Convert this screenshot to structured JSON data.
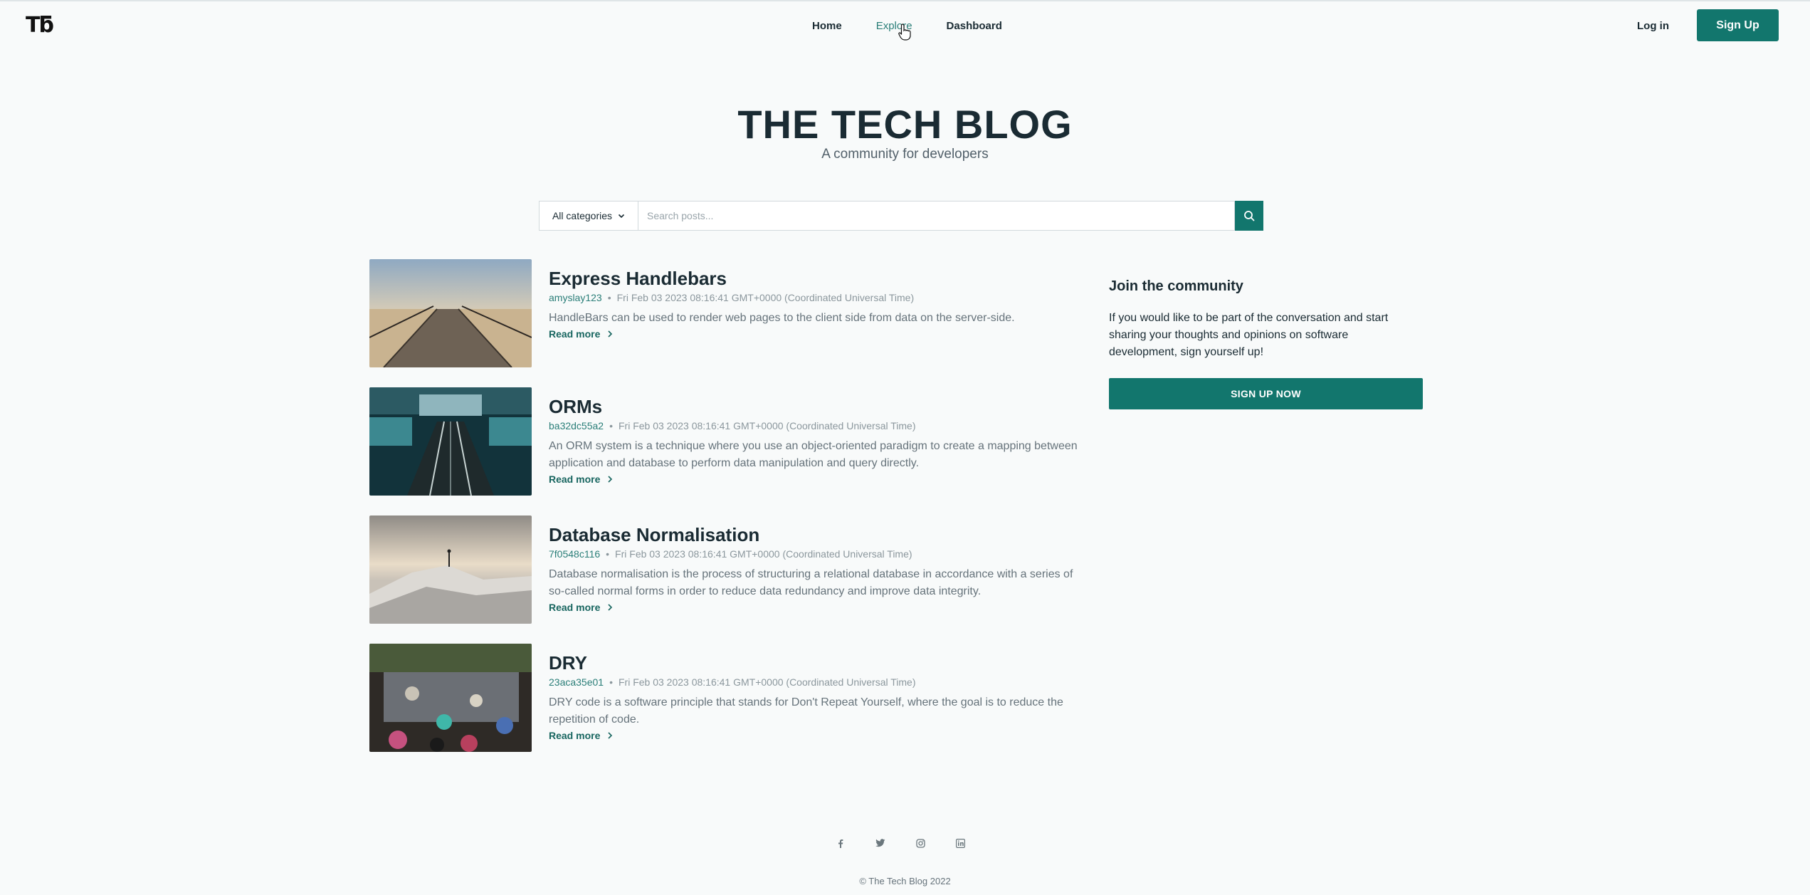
{
  "header": {
    "logo": "Tƃ",
    "nav": [
      {
        "label": "Home"
      },
      {
        "label": "Explore"
      },
      {
        "label": "Dashboard"
      }
    ],
    "login_label": "Log in",
    "signup_label": "Sign Up"
  },
  "hero": {
    "title": "THE TECH BLOG",
    "subtitle": "A community for developers"
  },
  "search": {
    "category_label": "All categories",
    "placeholder": "Search posts..."
  },
  "posts": [
    {
      "title": "Express Handlebars",
      "author": "amyslay123",
      "date": "Fri Feb 03 2023 08:16:41 GMT+0000 (Coordinated Universal Time)",
      "excerpt": "HandleBars can be used to render web pages to the client side from data on the server-side.",
      "read_more": "Read more"
    },
    {
      "title": "ORMs",
      "author": "ba32dc55a2",
      "date": "Fri Feb 03 2023 08:16:41 GMT+0000 (Coordinated Universal Time)",
      "excerpt": "An ORM system is a technique where you use an object-oriented paradigm to create a mapping between application and database to perform data manipulation and query directly.",
      "read_more": "Read more"
    },
    {
      "title": "Database Normalisation",
      "author": "7f0548c116",
      "date": "Fri Feb 03 2023 08:16:41 GMT+0000 (Coordinated Universal Time)",
      "excerpt": "Database normalisation is the process of structuring a relational database in accordance with a series of so-called normal forms in order to reduce data redundancy and improve data integrity.",
      "read_more": "Read more"
    },
    {
      "title": "DRY",
      "author": "23aca35e01",
      "date": "Fri Feb 03 2023 08:16:41 GMT+0000 (Coordinated Universal Time)",
      "excerpt": "DRY code is a software principle that stands for Don't Repeat Yourself, where the goal is to reduce the repetition of code.",
      "read_more": "Read more"
    }
  ],
  "sidebar": {
    "title": "Join the community",
    "text": "If you would like to be part of the conversation and start sharing your thoughts and opinions on software development, sign yourself up!",
    "button_label": "SIGN UP NOW"
  },
  "footer": {
    "social_icons": [
      "facebook-icon",
      "twitter-icon",
      "instagram-icon",
      "linkedin-icon"
    ],
    "copyright": "© The Tech Blog 2022"
  },
  "colors": {
    "accent": "#12766d",
    "background": "#f8fafa",
    "text": "#1a2b33"
  }
}
